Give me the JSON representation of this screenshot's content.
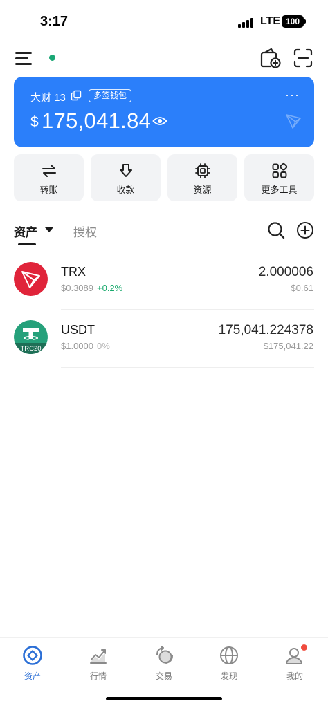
{
  "status_bar": {
    "time": "3:17",
    "network": "LTE",
    "battery": "100"
  },
  "wallet": {
    "name": "大财 13",
    "badge": "多签钱包",
    "currency_symbol": "$",
    "balance": "175,041.84",
    "more": "···"
  },
  "actions": [
    {
      "label": "转账",
      "icon": "transfer-icon"
    },
    {
      "label": "收款",
      "icon": "receive-icon"
    },
    {
      "label": "资源",
      "icon": "chip-icon"
    },
    {
      "label": "更多工具",
      "icon": "grid-tools-icon"
    }
  ],
  "tabs": {
    "assets": "资产",
    "authorization": "授权"
  },
  "tokens": [
    {
      "symbol": "TRX",
      "price": "$0.3089",
      "change": "+0.2%",
      "amount": "2.000006",
      "value": "$0.61",
      "change_color": "#18a96c",
      "logo_color": "#e0243a"
    },
    {
      "symbol": "USDT",
      "price": "$1.0000",
      "change": "0%",
      "amount": "175,041.224378",
      "value": "$175,041.22",
      "change_color": "#b0b0b0",
      "logo_color": "#26a17b",
      "logo_tag": "TRC20"
    }
  ],
  "bottom_nav": [
    {
      "label": "资产",
      "icon": "assets-icon",
      "active": true
    },
    {
      "label": "行情",
      "icon": "market-icon",
      "active": false
    },
    {
      "label": "交易",
      "icon": "trade-icon",
      "active": false
    },
    {
      "label": "发现",
      "icon": "discover-icon",
      "active": false
    },
    {
      "label": "我的",
      "icon": "profile-icon",
      "active": false
    }
  ],
  "colors": {
    "accent": "#2b7ffa",
    "nav_active": "#2b6fd6",
    "positive": "#18a96c",
    "online": "#1aa775",
    "notify": "#f04c3e"
  }
}
